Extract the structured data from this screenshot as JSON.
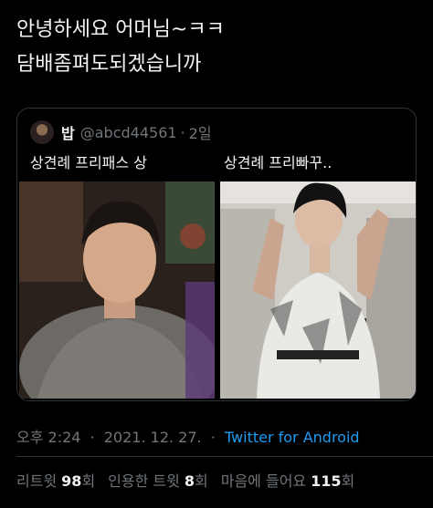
{
  "tweet": {
    "lines": [
      "안녕하세요 어머님~ㅋㅋ",
      "담배좀펴도되겠습니까"
    ]
  },
  "quote": {
    "name": "밥",
    "handle": "@abcd44561",
    "dot": "·",
    "time": "2일",
    "caption_left": "상견례 프리패스 상",
    "caption_right": "상견례 프리빠꾸.."
  },
  "meta": {
    "time": "오후 2:24",
    "date": "2021. 12. 27.",
    "source": "Twitter for Android",
    "sep": "·"
  },
  "stats": {
    "retweets_label": "리트윗",
    "retweets_value": "98",
    "retweets_unit": "회",
    "quotes_label": "인용한 트윗",
    "quotes_value": "8",
    "quotes_unit": "회",
    "likes_label": "마음에 들어요",
    "likes_value": "115",
    "likes_unit": "회"
  },
  "colors": {
    "background": "#000000",
    "link": "#1d9bf0",
    "muted": "#71767b",
    "border": "#2f3336"
  }
}
